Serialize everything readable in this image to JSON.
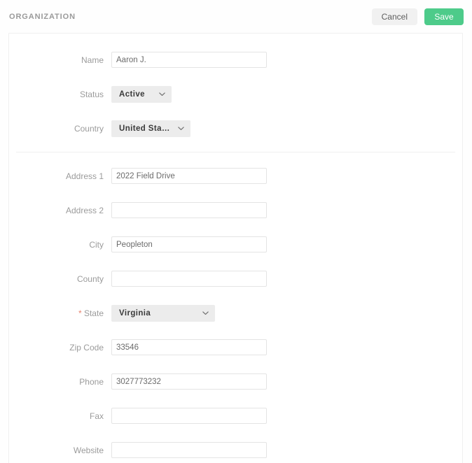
{
  "header": {
    "title": "ORGANIZATION",
    "cancel_label": "Cancel",
    "save_label": "Save",
    "save_color": "#4DCB8A",
    "cancel_bg": "#F1F1F1"
  },
  "form": {
    "sections": [
      {
        "fields": [
          {
            "label": "Name",
            "type": "text",
            "value": "Aaron J.",
            "placeholder": "",
            "required": false
          },
          {
            "label": "Status",
            "type": "select",
            "value": "Active",
            "required": false
          },
          {
            "label": "Country",
            "type": "select",
            "value": "United States",
            "required": false
          }
        ]
      },
      {
        "fields": [
          {
            "label": "Address 1",
            "type": "text",
            "value": "2022 Field Drive",
            "placeholder": "",
            "required": false
          },
          {
            "label": "Address 2",
            "type": "text",
            "value": "",
            "placeholder": "",
            "required": false
          },
          {
            "label": "City",
            "type": "text",
            "value": "Peopleton",
            "placeholder": "",
            "required": false
          },
          {
            "label": "County",
            "type": "text",
            "value": "",
            "placeholder": "",
            "required": false
          },
          {
            "label": "State",
            "type": "select",
            "value": "Virginia",
            "required": true
          },
          {
            "label": "Zip Code",
            "type": "text",
            "value": "33546",
            "placeholder": "",
            "required": false
          },
          {
            "label": "Phone",
            "type": "text",
            "value": "3027773232",
            "placeholder": "",
            "required": false
          },
          {
            "label": "Fax",
            "type": "text",
            "value": "",
            "placeholder": "",
            "required": false
          },
          {
            "label": "Website",
            "type": "text",
            "value": "",
            "placeholder": "",
            "required": false
          }
        ]
      }
    ],
    "required_marker": "*",
    "required_marker_color": "#E8836F",
    "chevron_icon": "chevron-down-icon"
  }
}
